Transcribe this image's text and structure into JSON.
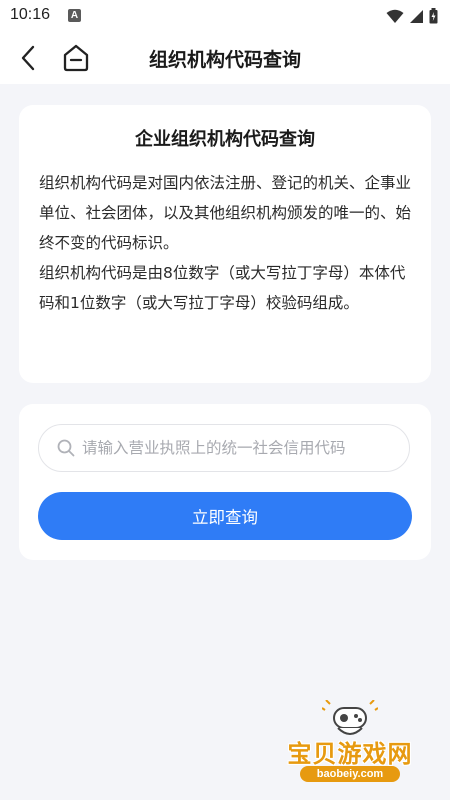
{
  "status_bar": {
    "time": "10:16",
    "notification_badge": "A",
    "icons": [
      "wifi-icon",
      "signal-icon",
      "battery-icon"
    ]
  },
  "nav": {
    "title": "组织机构代码查询",
    "icons": [
      "back-arrow-icon",
      "home-icon"
    ]
  },
  "info_card": {
    "title": "企业组织机构代码查询",
    "paragraphs": [
      "组织机构代码是对国内依法注册、登记的机关、企事业单位、社会团体，以及其他组织机构颁发的唯一的、始终不变的代码标识。",
      "组织机构代码是由8位数字（或大写拉丁字母）本体代码和1位数字（或大写拉丁字母）校验码组成。"
    ]
  },
  "search": {
    "placeholder": "请输入营业执照上的统一社会信用代码",
    "value": "",
    "button_label": "立即查询",
    "icon": "search-icon"
  },
  "watermark": {
    "name": "宝贝游戏网",
    "url": "baobeiy.com"
  },
  "colors": {
    "accent": "#2f7cf6",
    "background": "#f4f5f9",
    "card": "#ffffff",
    "watermark": "#e79a10"
  }
}
